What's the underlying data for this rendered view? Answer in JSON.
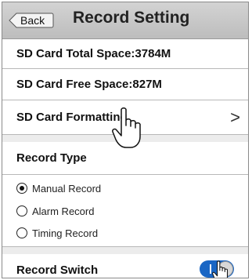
{
  "header": {
    "back_label": "Back",
    "title": "Record Setting"
  },
  "rows": {
    "total_space": "SD Card Total Space:3784M",
    "free_space": "SD Card Free Space:827M",
    "formatting": "SD Card Formatting",
    "formatting_chevron": ">",
    "record_type": "Record Type",
    "record_switch": "Record Switch"
  },
  "record_type_options": [
    {
      "label": "Manual Record",
      "selected": true
    },
    {
      "label": "Alarm Record",
      "selected": false
    },
    {
      "label": "Timing Record",
      "selected": false
    }
  ],
  "record_switch_on": true,
  "colors": {
    "toggle_on": "#1a66c4",
    "header_bg": "#c8c8c8"
  }
}
